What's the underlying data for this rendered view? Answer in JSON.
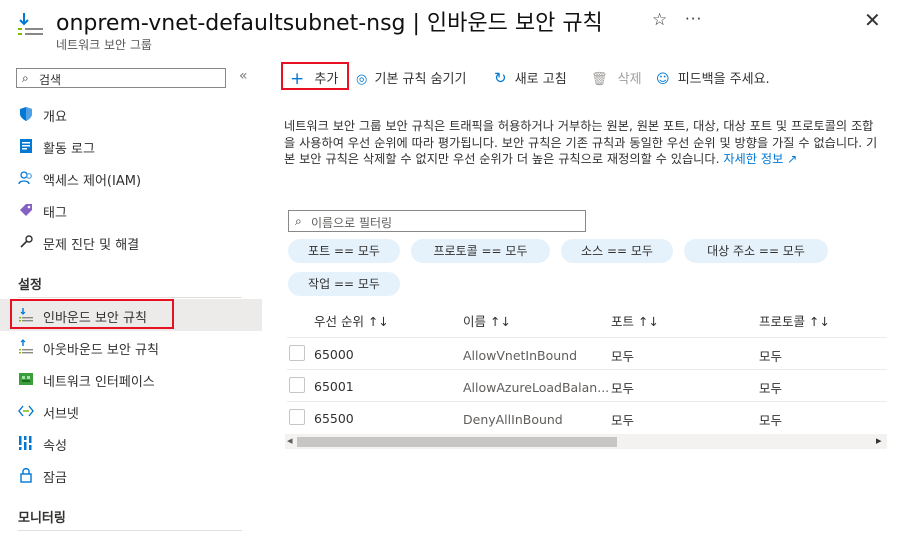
{
  "header": {
    "title": "onprem-vnet-defaultsubnet-nsg | 인바운드 보안 규칙",
    "subtitle": "네트워크 보안 그룹",
    "star": "☆",
    "more": "···",
    "close": "✕"
  },
  "sidebar": {
    "search_placeholder": "검색",
    "collapse": "«",
    "items": [
      {
        "label": "개요",
        "icon": "shield-icon"
      },
      {
        "label": "활동 로그",
        "icon": "log-icon"
      },
      {
        "label": "액세스 제어(IAM)",
        "icon": "people-icon"
      },
      {
        "label": "태그",
        "icon": "tag-icon"
      },
      {
        "label": "문제 진단 및 해결",
        "icon": "wrench-icon"
      }
    ],
    "section_settings": "설정",
    "settings_items": [
      {
        "label": "인바운드 보안 규칙",
        "icon": "inbound-icon",
        "selected": true
      },
      {
        "label": "아웃바운드 보안 규칙",
        "icon": "outbound-icon"
      },
      {
        "label": "네트워크 인터페이스",
        "icon": "nic-icon"
      },
      {
        "label": "서브넷",
        "icon": "subnet-icon"
      },
      {
        "label": "속성",
        "icon": "properties-icon"
      },
      {
        "label": "잠금",
        "icon": "lock-icon"
      }
    ],
    "section_monitoring": "모니터링"
  },
  "toolbar": {
    "add": "추가",
    "hide_default": "기본 규칙 숨기기",
    "refresh": "새로 고침",
    "delete": "삭제",
    "feedback": "피드백을 주세요."
  },
  "description": {
    "text": "네트워크 보안 그룹 보안 규칙은 트래픽을 허용하거나 거부하는 원본, 원본 포트, 대상, 대상 포트 및 프로토콜의 조합을 사용하여 우선 순위에 따라 평가됩니다. 보안 규칙은 기존 규칙과 동일한 우선 순위 및 방향을 가질 수 없습니다. 기본 보안 규칙은 삭제할 수 없지만 우선 순위가 더 높은 규칙으로 재정의할 수 있습니다.",
    "link": "자세한 정보"
  },
  "filter": {
    "placeholder": "이름으로 필터링",
    "pills": [
      "포트 == 모두",
      "프로토콜 == 모두",
      "소스 == 모두",
      "대상 주소 == 모두",
      "작업 == 모두"
    ]
  },
  "table": {
    "columns": [
      "우선 순위 ↑↓",
      "이름 ↑↓",
      "포트 ↑↓",
      "프로토콜 ↑↓"
    ],
    "rows": [
      {
        "priority": "65000",
        "name": "AllowVnetInBound",
        "port": "모두",
        "protocol": "모두"
      },
      {
        "priority": "65001",
        "name": "AllowAzureLoadBalan...",
        "port": "모두",
        "protocol": "모두"
      },
      {
        "priority": "65500",
        "name": "DenyAllInBound",
        "port": "모두",
        "protocol": "모두"
      }
    ],
    "scroll_left": "◂",
    "scroll_right": "▸"
  },
  "colors": {
    "accent": "#0078d4",
    "highlight": "#e81123"
  }
}
